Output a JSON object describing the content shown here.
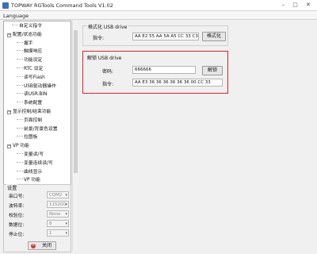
{
  "window": {
    "title": "TOPWAY RGTools Command Tools V1.02",
    "controls": "–  ▢  ✕"
  },
  "menu": {
    "language": "Language"
  },
  "tree": [
    {
      "label": "自定义指令",
      "depth": 1,
      "expander": ""
    },
    {
      "label": "配置/状态功能",
      "depth": 0,
      "expander": "−"
    },
    {
      "label": "握手",
      "depth": 2,
      "expander": ""
    },
    {
      "label": "触摸响应",
      "depth": 2,
      "expander": ""
    },
    {
      "label": "功能设定",
      "depth": 2,
      "expander": ""
    },
    {
      "label": "RTC 设定",
      "depth": 2,
      "expander": ""
    },
    {
      "label": "读写Flash",
      "depth": 2,
      "expander": ""
    },
    {
      "label": "USB驱动器操作",
      "depth": 2,
      "expander": ""
    },
    {
      "label": "读USR.BIN",
      "depth": 2,
      "expander": ""
    },
    {
      "label": "系统配置",
      "depth": 2,
      "expander": ""
    },
    {
      "label": "显示控制/结束功能",
      "depth": 0,
      "expander": "−"
    },
    {
      "label": "页面控制",
      "depth": 2,
      "expander": ""
    },
    {
      "label": "前景/背景色设置",
      "depth": 2,
      "expander": ""
    },
    {
      "label": "拉图板",
      "depth": 2,
      "expander": ""
    },
    {
      "label": "VP 功能",
      "depth": 0,
      "expander": "−"
    },
    {
      "label": "变量读/写",
      "depth": 2,
      "expander": ""
    },
    {
      "label": "变量连续读/写",
      "depth": 2,
      "expander": ""
    },
    {
      "label": "曲线显示",
      "depth": 2,
      "expander": ""
    },
    {
      "label": "VP 功能",
      "depth": 2,
      "expander": ""
    }
  ],
  "settings": {
    "title": "设置",
    "rows": [
      {
        "label": "串口号:",
        "value": "COM2"
      },
      {
        "label": "波特率:",
        "value": "115200"
      },
      {
        "label": "校验位:",
        "value": "None"
      },
      {
        "label": "数据位:",
        "value": "8"
      },
      {
        "label": "停止位:",
        "value": "1"
      }
    ],
    "close_label": "关闭"
  },
  "format_section": {
    "title": "格式化 USB drive",
    "command_label": "指令:",
    "command_value": "AA E2 55 AA 5A A5 CC 33 C3 3C",
    "button_label": "格式化"
  },
  "unlock_section": {
    "title": "解锁 USB drive",
    "password_label": "密码:",
    "password_value": "666666",
    "button_label": "解锁",
    "command_label": "指令:",
    "command_value": "AA E3 36 36 36 36 36 36  00 CC 33"
  },
  "colors": {
    "highlight": "#d9232d",
    "close_icon": "#d43a2f"
  }
}
